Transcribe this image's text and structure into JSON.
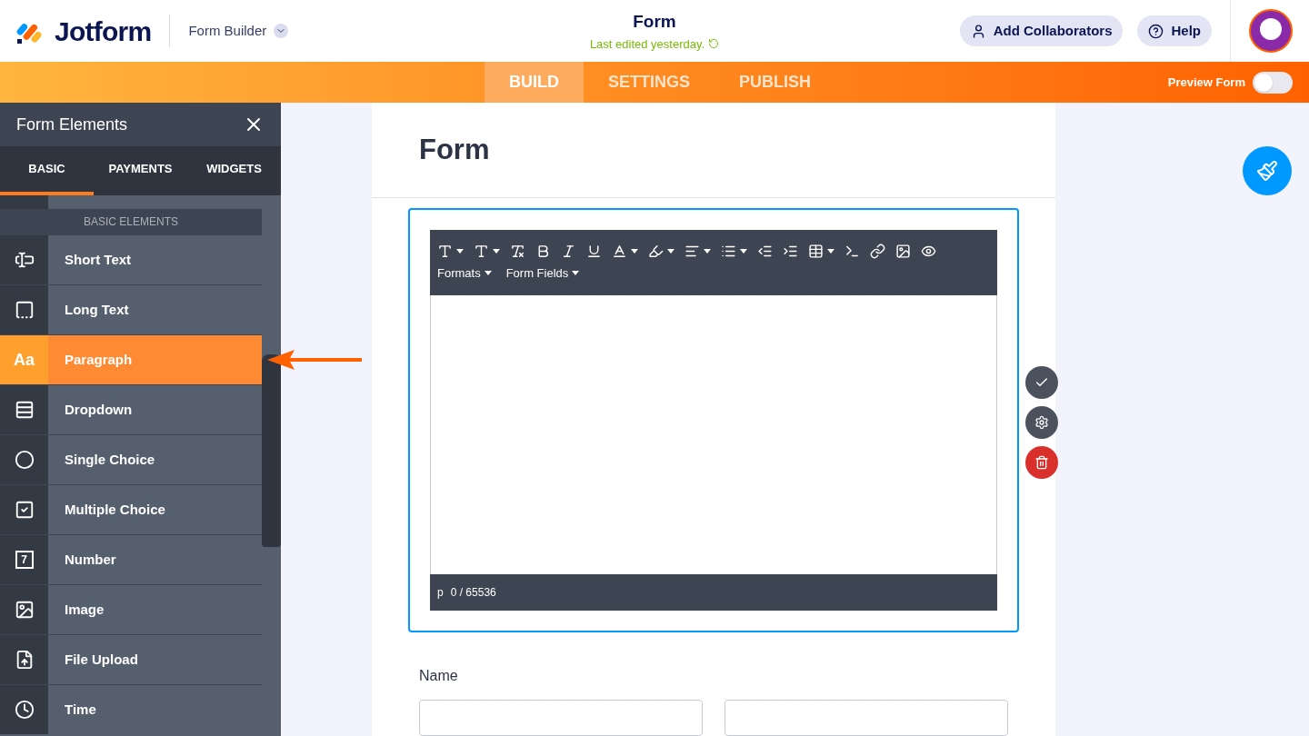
{
  "header": {
    "logo": "Jotform",
    "app_menu": "Form Builder",
    "title": "Form",
    "last_edited": "Last edited yesterday.",
    "buttons": [
      {
        "kind": "collaborators",
        "label": "Add Collaborators"
      },
      {
        "kind": "help",
        "label": "Help"
      }
    ]
  },
  "nav": {
    "tabs": [
      {
        "label": "BUILD",
        "selected": true
      },
      {
        "label": "SETTINGS",
        "selected": false
      },
      {
        "label": "PUBLISH",
        "selected": false
      }
    ],
    "preview": {
      "label": "Preview Form",
      "on": false
    }
  },
  "sidebar": {
    "title": "Form Elements",
    "tabs": [
      {
        "label": "BASIC",
        "selected": true
      },
      {
        "label": "PAYMENTS",
        "selected": false
      },
      {
        "label": "WIDGETS",
        "selected": false
      }
    ],
    "section": "BASIC ELEMENTS",
    "items": [
      {
        "kind": "short-text",
        "label": "Short Text",
        "selected": false
      },
      {
        "kind": "long-text",
        "label": "Long Text",
        "selected": false
      },
      {
        "kind": "paragraph",
        "label": "Paragraph",
        "icon_text": "Aa",
        "selected": true
      },
      {
        "kind": "dropdown",
        "label": "Dropdown",
        "selected": false
      },
      {
        "kind": "single-choice",
        "label": "Single Choice",
        "selected": false
      },
      {
        "kind": "multiple-choice",
        "label": "Multiple Choice",
        "selected": false
      },
      {
        "kind": "number",
        "label": "Number",
        "icon_text": "7",
        "selected": false
      },
      {
        "kind": "image",
        "label": "Image",
        "selected": false
      },
      {
        "kind": "file-upload",
        "label": "File Upload",
        "selected": false
      },
      {
        "kind": "time",
        "label": "Time",
        "selected": false
      }
    ]
  },
  "form": {
    "title": "Form",
    "editor": {
      "toolbar_menus": [
        "Formats",
        "Form Fields"
      ],
      "status_tag": "p",
      "char_count": "0 / 65536"
    },
    "fields": [
      {
        "label": "Name"
      }
    ]
  }
}
